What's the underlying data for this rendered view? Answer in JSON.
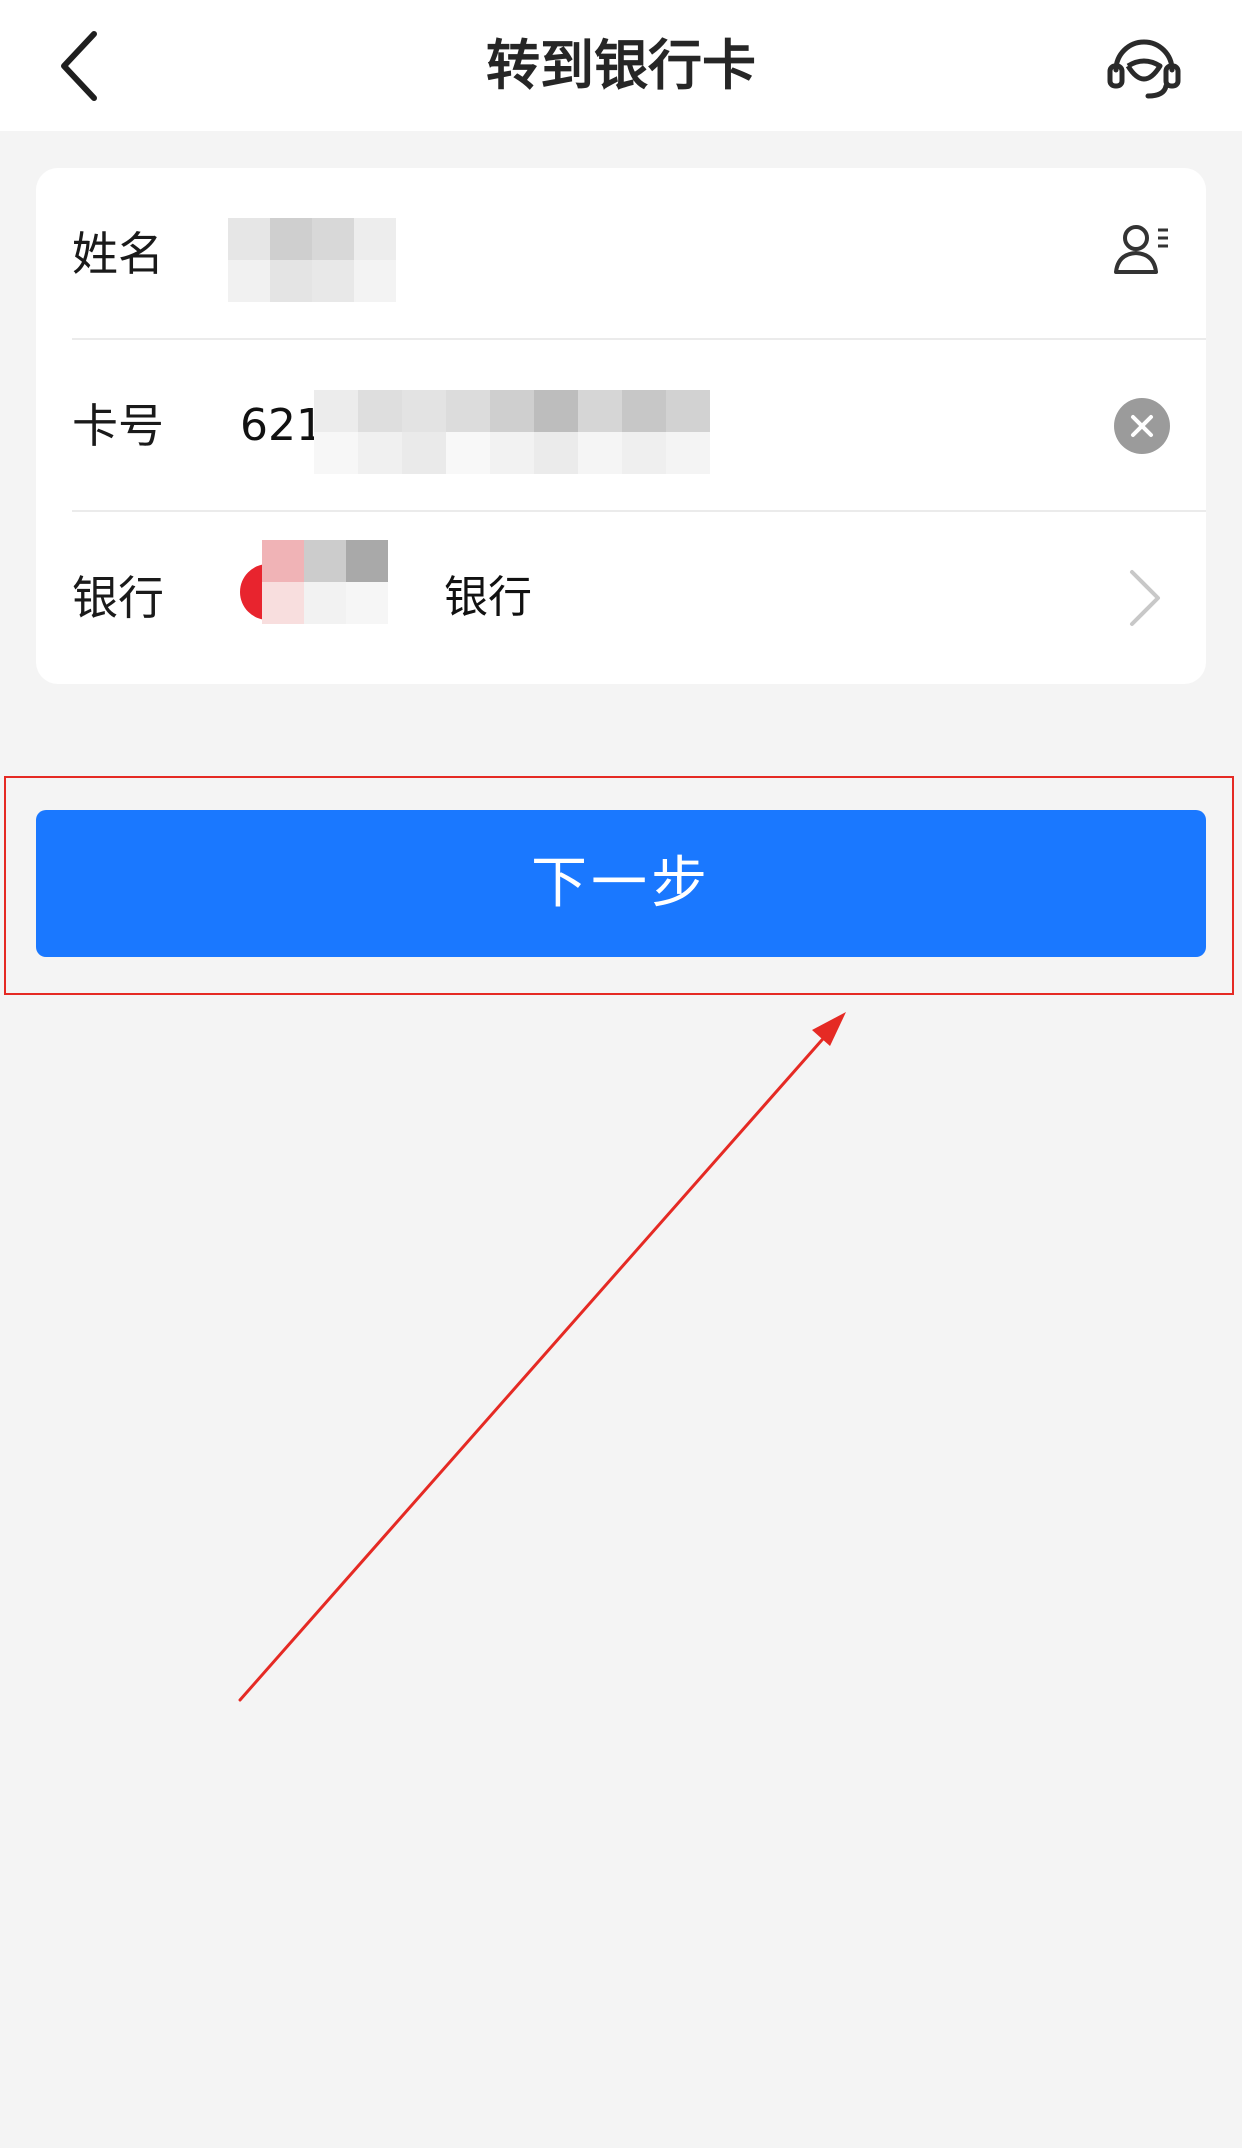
{
  "nav": {
    "title": "转到银行卡",
    "back_icon": "chevron-left-icon",
    "service_icon": "headset-icon"
  },
  "form": {
    "name": {
      "label": "姓名",
      "value": "",
      "icon": "contact-book-icon"
    },
    "card": {
      "label": "卡号",
      "value_visible": "621",
      "clear_icon": "clear-icon"
    },
    "bank": {
      "label": "银行",
      "value_suffix": "银行",
      "chevron_icon": "chevron-right-icon"
    }
  },
  "next_button": {
    "label": "下一步"
  },
  "colors": {
    "accent": "#1a78ff",
    "annotation": "#e52a24",
    "background": "#f4f4f4"
  }
}
